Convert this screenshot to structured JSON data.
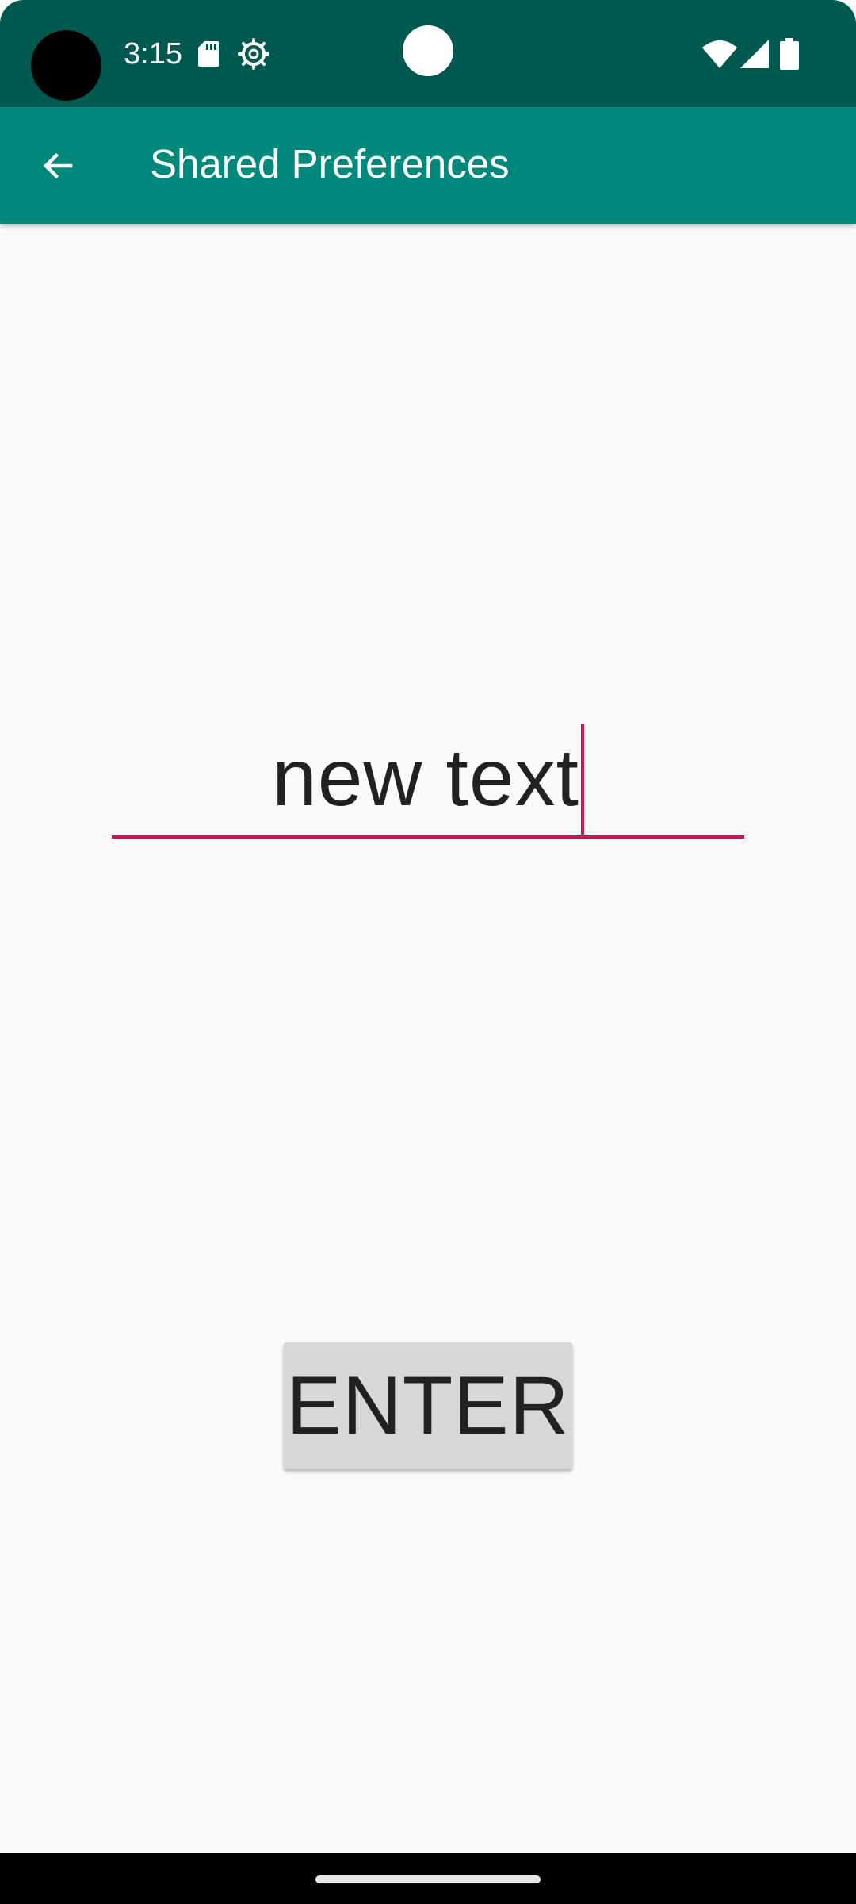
{
  "status_bar": {
    "time": "3:15",
    "icons": [
      "sd-card-icon",
      "settings-icon",
      "wifi-icon",
      "cell-signal-icon",
      "battery-icon"
    ],
    "background_color": "#00594e"
  },
  "app_bar": {
    "title": "Shared Preferences",
    "back_icon": "arrow-back-icon",
    "background_color": "#00897b"
  },
  "edit_text": {
    "value": "new text",
    "accent_color": "#c2185b"
  },
  "enter_button": {
    "label": "ENTER"
  },
  "navigation": {
    "gesture_handle": "home-pill"
  }
}
